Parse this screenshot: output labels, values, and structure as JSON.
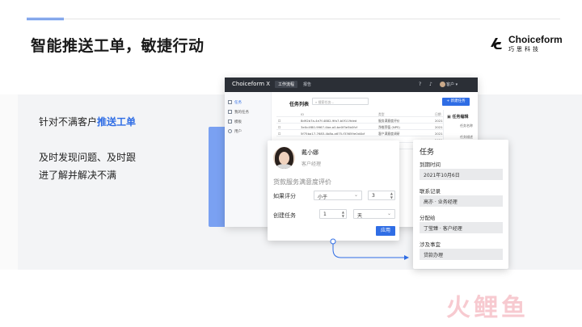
{
  "slide": {
    "title": "智能推送工单，敏捷行动",
    "lead_plain": "针对不满客户",
    "lead_highlight": "推送工单",
    "desc_line1": "及时发现问题、及时跟",
    "desc_line2": "进了解并解决不满"
  },
  "logo": {
    "name": "Choiceform",
    "sub": "巧思科技"
  },
  "app": {
    "title": "Choiceform X",
    "tabs": [
      {
        "label": "工作流程",
        "active": true
      },
      {
        "label": "报告",
        "active": false
      }
    ],
    "help_icon": "?",
    "bell_icon": "♪",
    "user_label": "客户 ▾",
    "sidebar": [
      {
        "label": "任务",
        "active": true
      },
      {
        "label": "我的任务",
        "active": false
      },
      {
        "label": "模板",
        "active": false
      },
      {
        "label": "用户",
        "active": false
      }
    ],
    "list_title": "任务列表",
    "search_placeholder": "搜索任务...",
    "new_task_label": "+ 新建任务",
    "table": {
      "headers": [
        "ID",
        "",
        "类型",
        "日期"
      ],
      "rows": [
        [
          "8d92b7a-4e7f-4882-9fa7-b0f119ded",
          "",
          "服务满意度评价",
          "2021"
        ],
        [
          "3e0c4f80-9967-4be-a0-be0f3e5b0fcf",
          "",
          "净推荐值 (NPS)",
          "2021"
        ],
        [
          "5f75ba17-7683-4b8a-a675-f33659e0d4bf",
          "",
          "客户满意度调研",
          "2021"
        ],
        [
          "",
          "",
          "",
          "2021"
        ],
        [
          "",
          "",
          "",
          "2021"
        ]
      ]
    },
    "edit_pane": {
      "title": "任务编辑",
      "labels": [
        "任务名称",
        "任务描述"
      ]
    }
  },
  "survey_card": {
    "person_name": "戴小娜",
    "person_role": "客户经理",
    "survey_title": "货款服务满意度评价",
    "condition_label": "如果评分",
    "operator_value": "小于",
    "score_value": "3",
    "create_label": "创建任务",
    "amount_value": "1",
    "unit_value": "天",
    "apply_label": "应用"
  },
  "task_card": {
    "title": "任务",
    "fields": [
      {
        "label": "到期时间",
        "value": "2021年10月6日"
      },
      {
        "label": "联系记录",
        "value": "高亦 · 业务经理"
      },
      {
        "label": "分配给",
        "value": "丁莹臻 · 客户经理"
      },
      {
        "label": "涉及事宜",
        "value": "贷款办理"
      }
    ]
  },
  "watermark": {
    "text": "火鲤鱼"
  },
  "colors": {
    "accent": "#2f6de5",
    "panel_blue": "#7aa1f2",
    "dark_bar": "#2b2f36",
    "band_gray": "#f3f4f6"
  }
}
